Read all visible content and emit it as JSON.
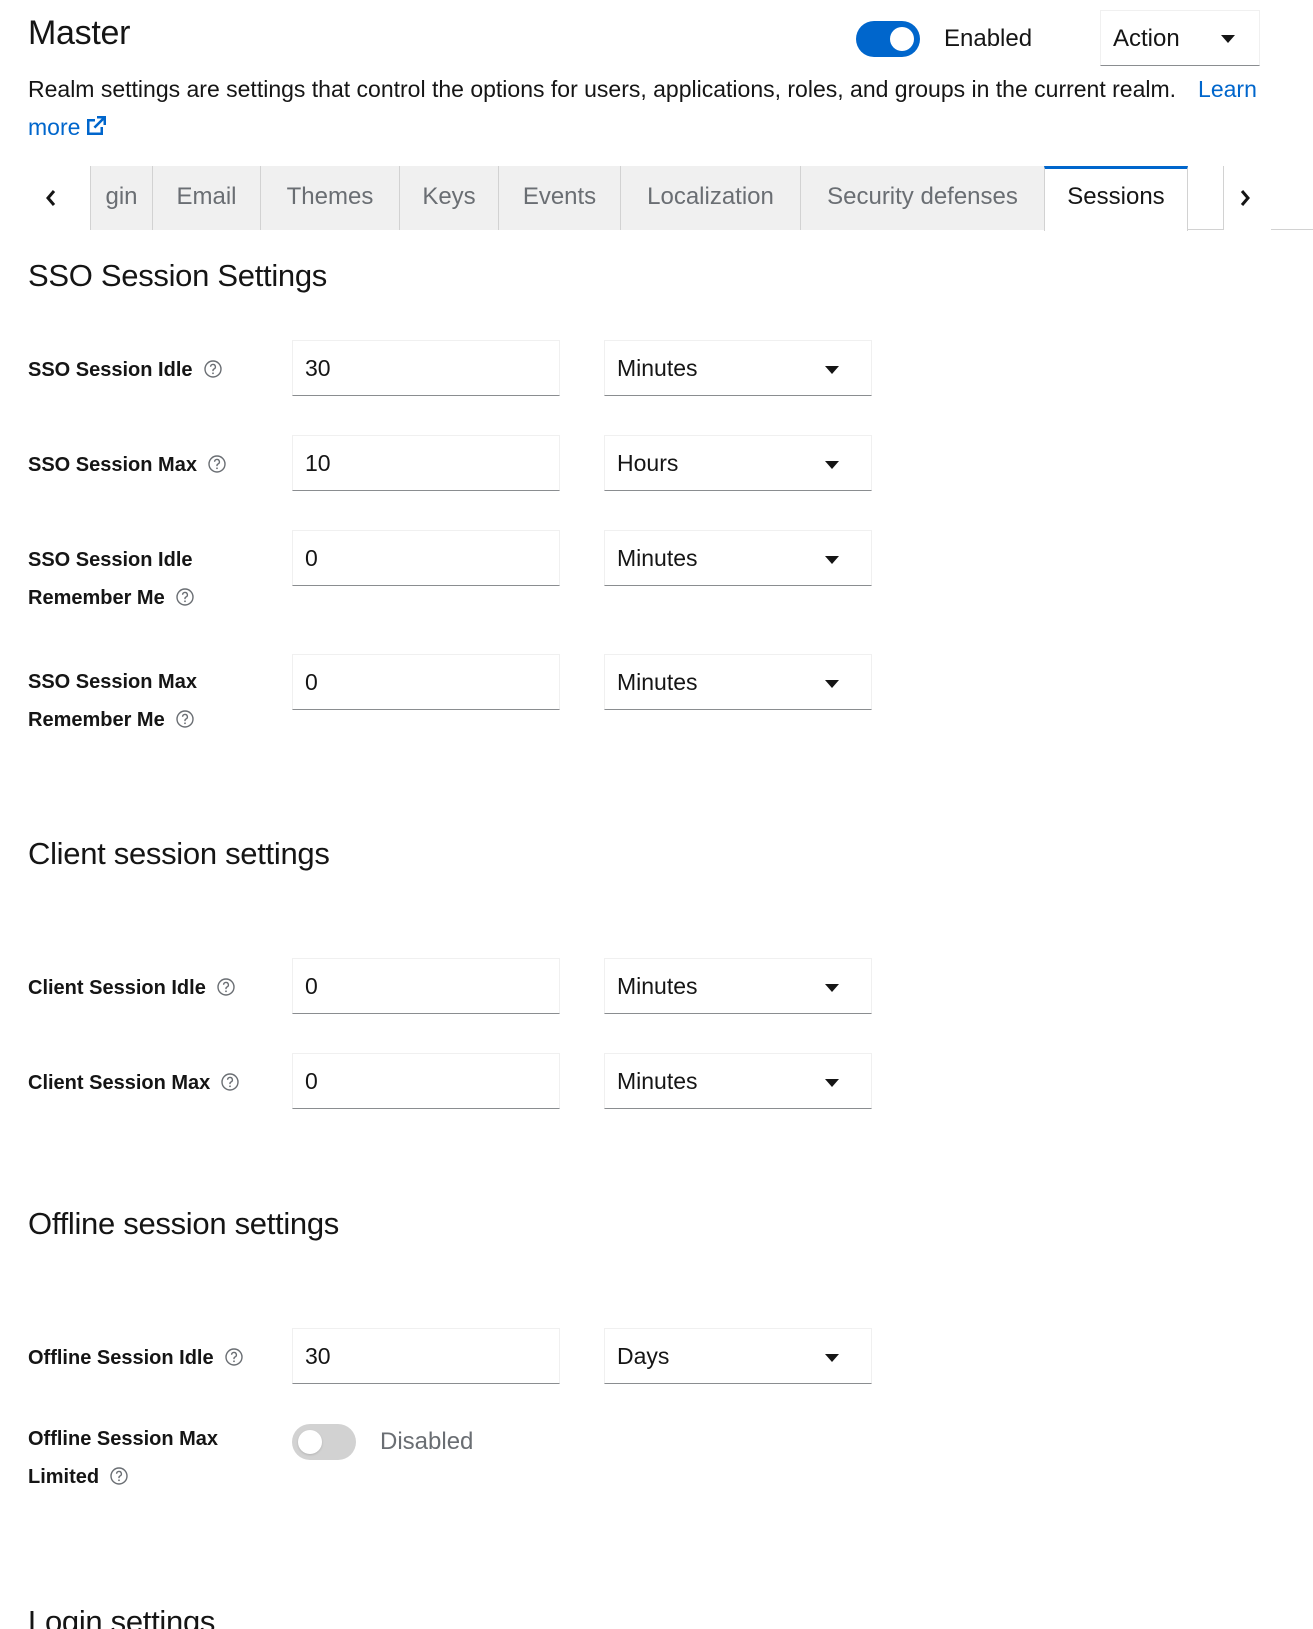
{
  "header": {
    "title": "Master",
    "enabled_label": "Enabled",
    "enabled": true,
    "action_label": "Action",
    "description": "Realm settings are settings that control the options for users, applications, roles, and groups in the current realm.",
    "learn_more": "Learn more"
  },
  "tabs": [
    {
      "label": "gin",
      "active": false
    },
    {
      "label": "Email",
      "active": false
    },
    {
      "label": "Themes",
      "active": false
    },
    {
      "label": "Keys",
      "active": false
    },
    {
      "label": "Events",
      "active": false
    },
    {
      "label": "Localization",
      "active": false
    },
    {
      "label": "Security defenses",
      "active": false
    },
    {
      "label": "Sessions",
      "active": true
    }
  ],
  "sso": {
    "title": "SSO Session Settings",
    "fields": [
      {
        "label": "SSO Session Idle",
        "label_line2": "",
        "value": "30",
        "unit": "Minutes"
      },
      {
        "label": "SSO Session Max",
        "label_line2": "",
        "value": "10",
        "unit": "Hours"
      },
      {
        "label": "SSO Session Idle",
        "label_line2": "Remember Me",
        "value": "0",
        "unit": "Minutes"
      },
      {
        "label": "SSO Session Max",
        "label_line2": "Remember Me",
        "value": "0",
        "unit": "Minutes"
      }
    ]
  },
  "client": {
    "title": "Client session settings",
    "fields": [
      {
        "label": "Client Session Idle",
        "value": "0",
        "unit": "Minutes"
      },
      {
        "label": "Client Session Max",
        "value": "0",
        "unit": "Minutes"
      }
    ]
  },
  "offline": {
    "title": "Offline session settings",
    "idle": {
      "label": "Offline Session Idle",
      "value": "30",
      "unit": "Days"
    },
    "max_limited": {
      "label": "Offline Session Max",
      "label_line2": "Limited",
      "state_label": "Disabled",
      "enabled": false
    }
  },
  "login": {
    "title": "Login settings"
  },
  "colors": {
    "accent": "#0066cc",
    "toggle_off": "#d2d2d2",
    "text": "#151515",
    "muted_text": "#6a6e73"
  }
}
